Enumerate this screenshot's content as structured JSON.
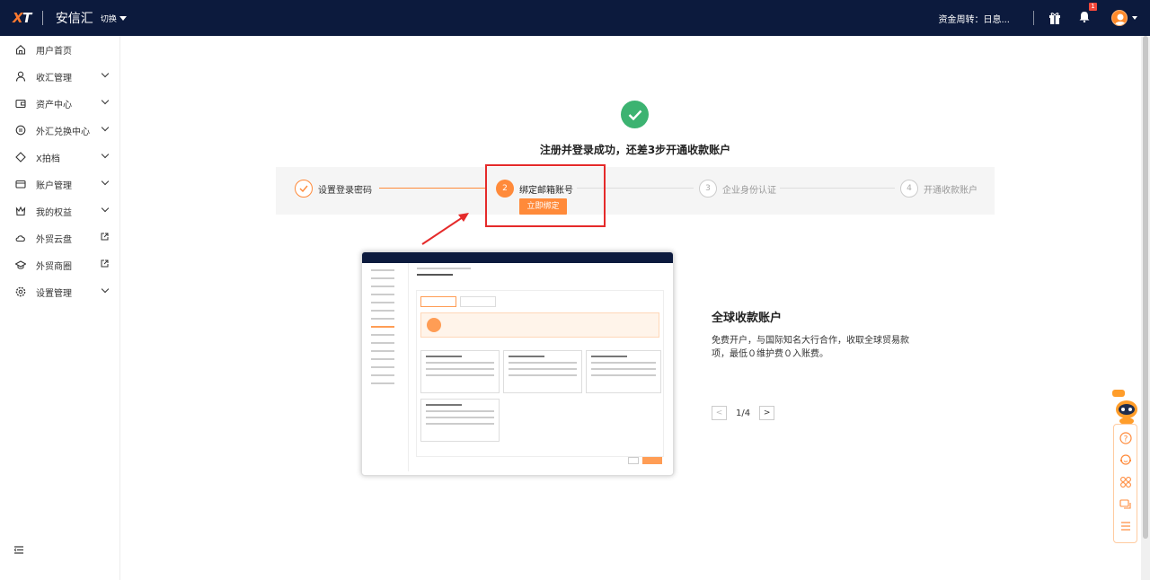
{
  "header": {
    "logo_main": "X",
    "logo_accent": "T",
    "brand_name": "安信汇",
    "switch_label": "切换",
    "fund_transfer": "资金周转：日息...",
    "notification_badge": "1"
  },
  "sidebar": {
    "items": [
      {
        "label": "用户首页",
        "icon": "home-icon",
        "arrow": "none"
      },
      {
        "label": "收汇管理",
        "icon": "user-icon",
        "arrow": "chevron"
      },
      {
        "label": "资产中心",
        "icon": "wallet-icon",
        "arrow": "chevron"
      },
      {
        "label": "外汇兑换中心",
        "icon": "exchange-icon",
        "arrow": "chevron"
      },
      {
        "label": "X拍档",
        "icon": "tag-icon",
        "arrow": "chevron"
      },
      {
        "label": "账户管理",
        "icon": "card-icon",
        "arrow": "chevron"
      },
      {
        "label": "我的权益",
        "icon": "crown-icon",
        "arrow": "chevron"
      },
      {
        "label": "外贸云盘",
        "icon": "cloud-icon",
        "arrow": "external"
      },
      {
        "label": "外贸商圈",
        "icon": "graduation-icon",
        "arrow": "external"
      },
      {
        "label": "设置管理",
        "icon": "settings-icon",
        "arrow": "chevron"
      }
    ]
  },
  "main": {
    "success_title": "注册并登录成功，还差3步开通收款账户",
    "steps": [
      {
        "num": "✓",
        "label": "设置登录密码",
        "state": "done"
      },
      {
        "num": "2",
        "label": "绑定邮箱账号",
        "state": "active"
      },
      {
        "num": "3",
        "label": "企业身份认证",
        "state": "todo"
      },
      {
        "num": "4",
        "label": "开通收款账户",
        "state": "todo"
      }
    ],
    "bind_button": "立即绑定",
    "info_title": "全球收款账户",
    "info_desc": "免费开户，与国际知名大行合作，收取全球贸易款项，最低０维护费０入账费。",
    "pager_text": "1/4",
    "pager_prev": "<",
    "pager_next": ">"
  },
  "colors": {
    "header_bg": "#0c1a3d",
    "accent": "#ff8a3a",
    "success": "#3cb371",
    "highlight": "#e52a2a"
  }
}
